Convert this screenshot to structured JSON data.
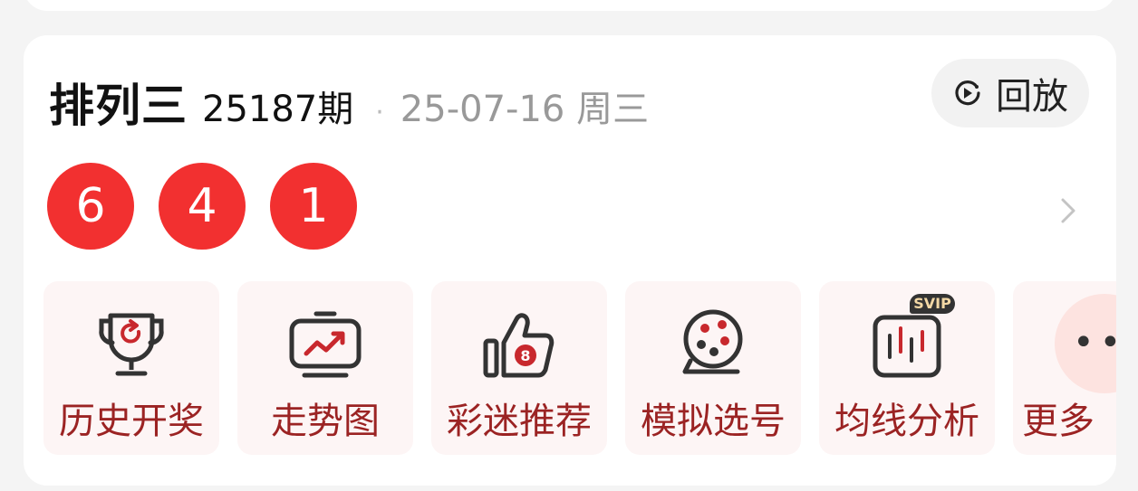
{
  "draw": {
    "lottery_name": "排列三",
    "issue": "25187期",
    "separator": "·",
    "date": "25-07-16 周三",
    "replay_label": "回放",
    "numbers": [
      "6",
      "4",
      "1"
    ]
  },
  "actions": [
    {
      "label": "历史开奖",
      "icon": "trophy-icon"
    },
    {
      "label": "走势图",
      "icon": "trend-chart-icon"
    },
    {
      "label": "彩迷推荐",
      "icon": "thumbs-up-icon"
    },
    {
      "label": "模拟选号",
      "icon": "lottery-ball-machine-icon"
    },
    {
      "label": "均线分析",
      "icon": "candlestick-chart-icon",
      "badge": "SVIP"
    },
    {
      "label": "更多",
      "icon": "more-icon"
    }
  ],
  "colors": {
    "ball": "#f23030",
    "action_bg": "#fdf5f5",
    "action_label": "#9b2323"
  }
}
